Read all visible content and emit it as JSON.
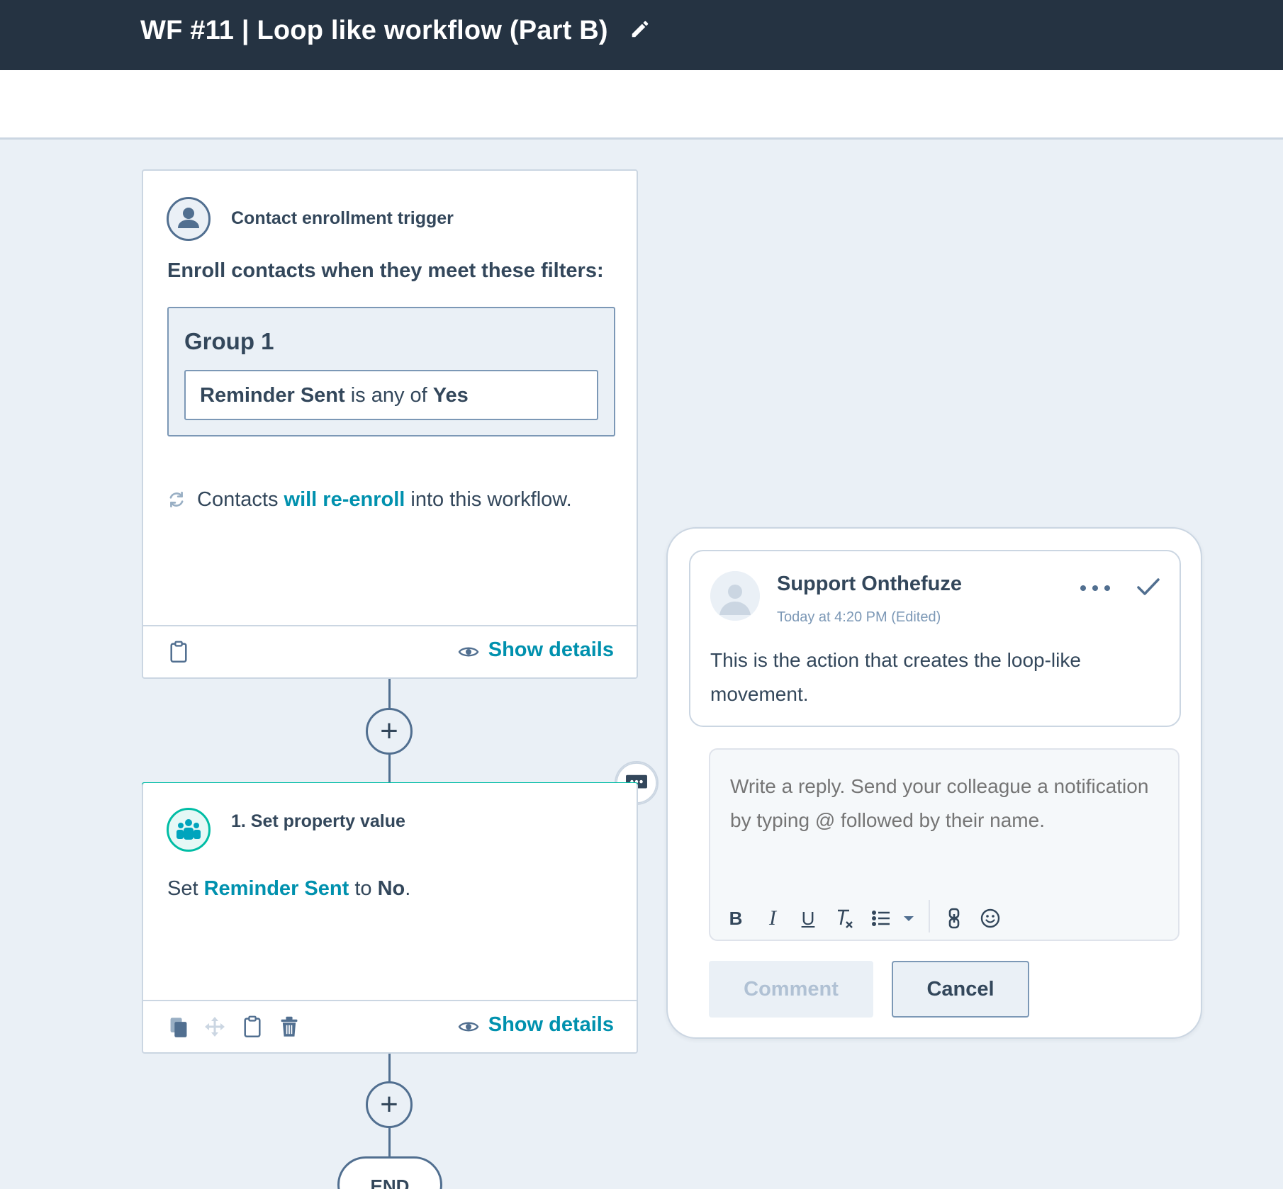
{
  "header": {
    "title": "WF #11 | Loop like workflow (Part B)",
    "edit_icon": "pencil-icon"
  },
  "trigger": {
    "heading": "Contact enrollment trigger",
    "enroll_text": "Enroll contacts when they meet these filters:",
    "group_title": "Group 1",
    "filter": {
      "property": "Reminder Sent",
      "operator": "is any of",
      "value": "Yes"
    },
    "reenroll": {
      "prefix": "Contacts",
      "link": "will re-enroll",
      "suffix": "into this workflow."
    },
    "show_details": "Show details"
  },
  "action": {
    "heading": "1. Set property value",
    "desc_prefix": "Set",
    "property": "Reminder Sent",
    "desc_middle": "to",
    "value": "No",
    "desc_suffix": ".",
    "show_details": "Show details"
  },
  "end_label": "END",
  "comment_panel": {
    "author": "Support Onthefuze",
    "timestamp": "Today at 4:20 PM  (Edited)",
    "body": "This is the action that creates the loop-like movement.",
    "reply_placeholder": "Write a reply. Send your colleague a notification by typing @ followed by their name.",
    "toolbar": {
      "bold": "B",
      "italic": "I",
      "underline": "U"
    },
    "comment_button": "Comment",
    "cancel_button": "Cancel"
  },
  "colors": {
    "header_bg": "#253342",
    "canvas_bg": "#eaf0f6",
    "link": "#0091ae",
    "action_accent": "#00bda5",
    "text": "#33475b"
  }
}
